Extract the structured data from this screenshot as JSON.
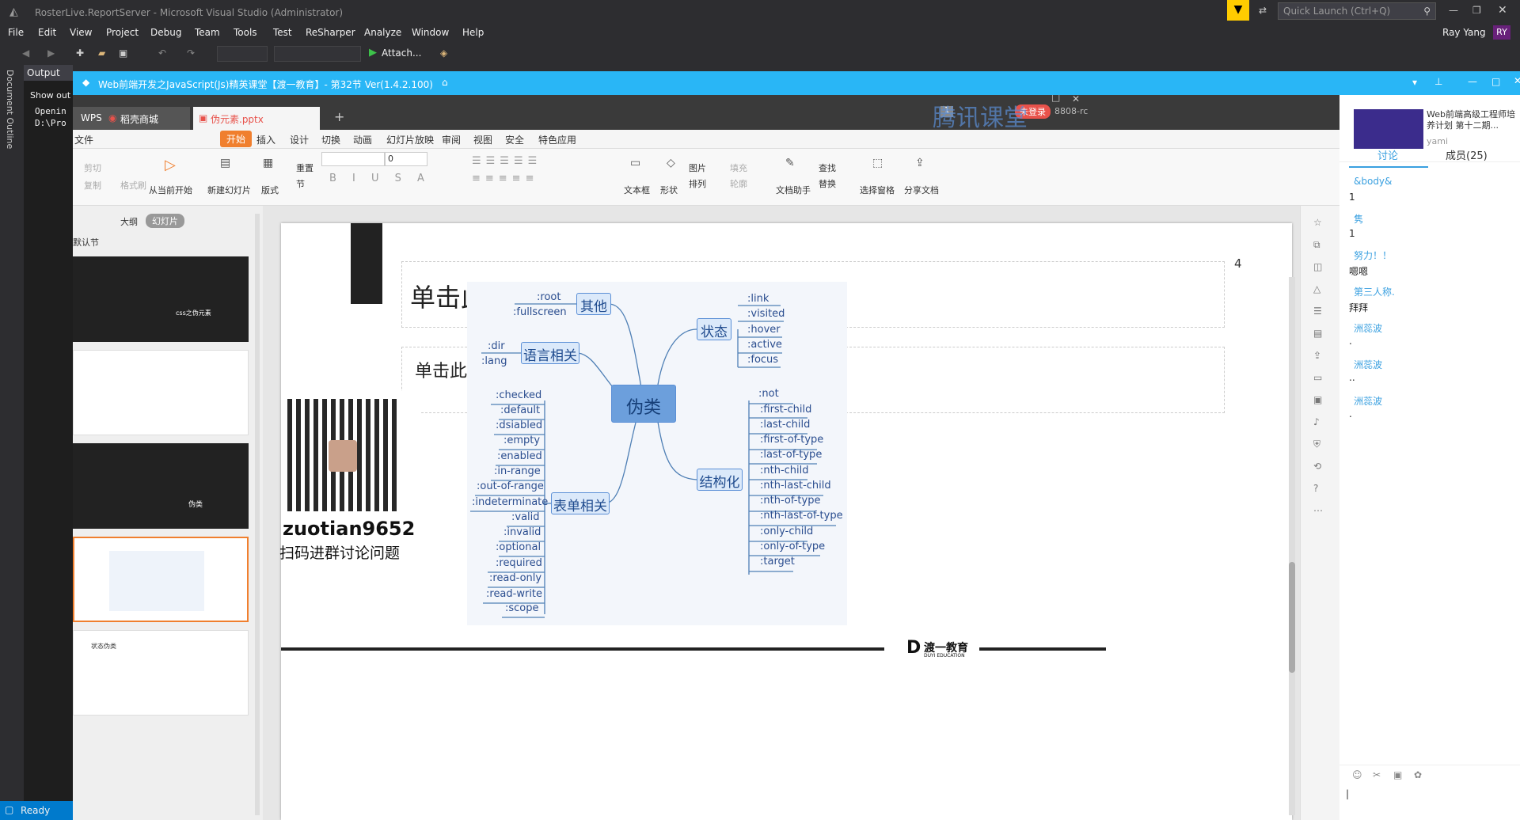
{
  "vs": {
    "title": "RosterLive.ReportServer - Microsoft Visual Studio (Administrator)",
    "menu": [
      "File",
      "Edit",
      "View",
      "Project",
      "Debug",
      "Team",
      "Tools",
      "Test",
      "ReSharper",
      "Analyze",
      "Window",
      "Help"
    ],
    "quick_launch": "Quick Launch (Ctrl+Q)",
    "user": "Ray Yang",
    "user_initials": "RY",
    "attach": "Attach...",
    "doc_outline": "Document Outline",
    "output_tab": "Output",
    "show_output": "Show out",
    "out_line1": "Openin",
    "out_line2": "D:\\Pro",
    "status": "Ready"
  },
  "tencent": {
    "title": "Web前端开发之JavaScript(Js)精英课堂【渡一教育】- 第32节 Ver(1.4.2.100)",
    "watermark": "腾讯课堂"
  },
  "wps": {
    "tabs": [
      "WPS",
      "稻壳商城",
      "伪元素.pptx"
    ],
    "login": "未登录",
    "code": "8808-rc",
    "menu": [
      "文件",
      "开始",
      "插入",
      "设计",
      "切换",
      "动画",
      "幻灯片放映",
      "审阅",
      "视图",
      "安全",
      "特色应用"
    ],
    "ribbon": [
      "剪切",
      "复制",
      "格式刷",
      "从当前开始",
      "新建幻灯片",
      "版式",
      "重置",
      "节",
      "文本框",
      "形状",
      "图片",
      "排列",
      "填充",
      "轮廓",
      "查找",
      "替换",
      "文档助手",
      "选择窗格",
      "分享文档"
    ],
    "font_size": "0",
    "outline_tab": "大纲",
    "slides_tab": "幻灯片",
    "section": "默认节",
    "thumb1_text": "css之伪元素",
    "thumb3_text": "伪类",
    "thumb5_text": "状态伪类",
    "footer_small": "渡一教育"
  },
  "slide": {
    "page_number": "4",
    "placeholder_title": "单击此处添加标题",
    "placeholder_sub": "单击此处添加",
    "qr_id": "zuotian9652",
    "qr_caption": "扫码进群讨论问题",
    "logo": "渡一教育",
    "logo_sub": "DUYI EDUCATION"
  },
  "mindmap": {
    "center": "伪类",
    "other": {
      "label": "其他",
      "items": [
        ":root",
        ":fullscreen"
      ]
    },
    "lang": {
      "label": "语言相关",
      "items": [
        ":dir",
        ":lang"
      ]
    },
    "form": {
      "label": "表单相关",
      "items": [
        ":checked",
        ":default",
        ":dsiabled",
        ":empty",
        ":enabled",
        ":in-range",
        ":out-of-range",
        ":indeterminate",
        ":valid",
        ":invalid",
        ":optional",
        ":required",
        ":read-only",
        ":read-write",
        ":scope"
      ]
    },
    "state": {
      "label": "状态",
      "items": [
        ":link",
        ":visited",
        ":hover",
        ":active",
        ":focus"
      ]
    },
    "struct": {
      "label": "结构化",
      "items": [
        ":not",
        ":first-child",
        ":last-child",
        ":first-of-type",
        ":last-of-type",
        ":nth-child",
        ":nth-last-child",
        ":nth-of-type",
        ":nth-last-of-type",
        ":only-child",
        ":only-of-type",
        ":target"
      ]
    }
  },
  "chat": {
    "course_title": "Web前端高级工程师培养计划 第十二期...",
    "teacher": "yami",
    "tab_discuss": "讨论",
    "tab_members": "成员(25)",
    "messages": [
      {
        "name": "&body&",
        "text": "1"
      },
      {
        "name": "隽",
        "text": "1"
      },
      {
        "name": "努力！！",
        "text": "嗯嗯"
      },
      {
        "name": "第三人称.",
        "text": "拜拜"
      },
      {
        "name": "洲蕊波",
        "text": "."
      },
      {
        "name": "洲蕊波",
        "text": ".."
      },
      {
        "name": "洲蕊波",
        "text": "."
      }
    ]
  }
}
